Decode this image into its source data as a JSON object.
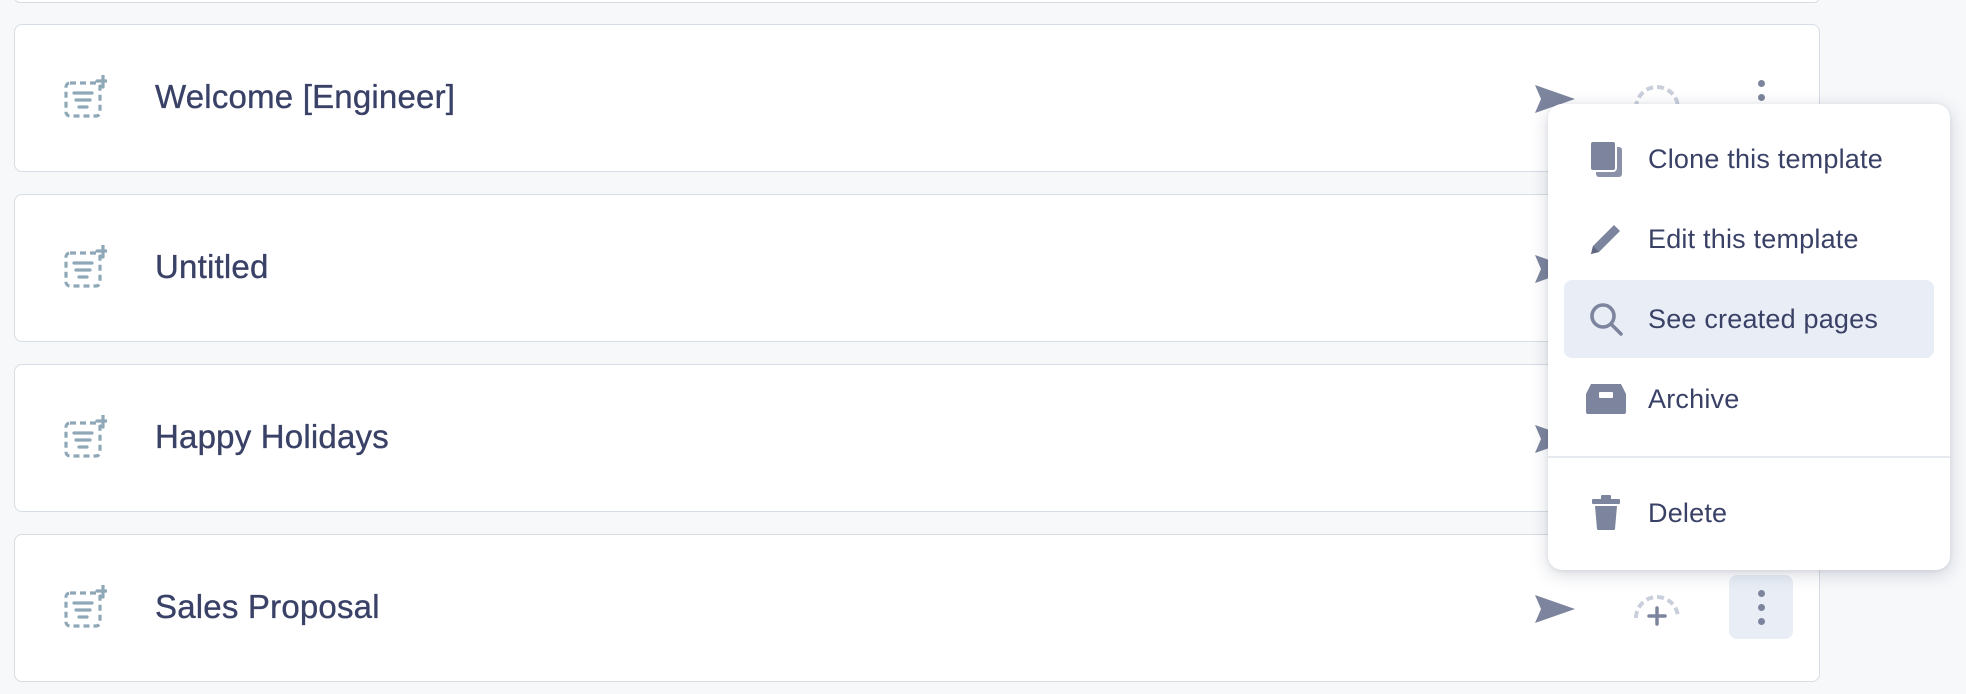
{
  "templates": [
    {
      "title": "Welcome [Engineer]"
    },
    {
      "title": "Untitled"
    },
    {
      "title": "Happy Holidays"
    },
    {
      "title": "Sales Proposal"
    }
  ],
  "context_menu": {
    "items": [
      {
        "label": "Clone this template",
        "icon": "clone-icon"
      },
      {
        "label": "Edit this template",
        "icon": "pencil-icon"
      },
      {
        "label": "See created pages",
        "icon": "search-icon"
      },
      {
        "label": "Archive",
        "icon": "archive-icon"
      },
      {
        "label": "Delete",
        "icon": "trash-icon"
      }
    ],
    "hovered_item": "See created pages"
  },
  "colors": {
    "text": "#3a4166",
    "icon_muted": "#7d859e",
    "template_icon": "#8fa8b8",
    "hover_bg": "#e9eef6",
    "border": "#d6dde4"
  }
}
